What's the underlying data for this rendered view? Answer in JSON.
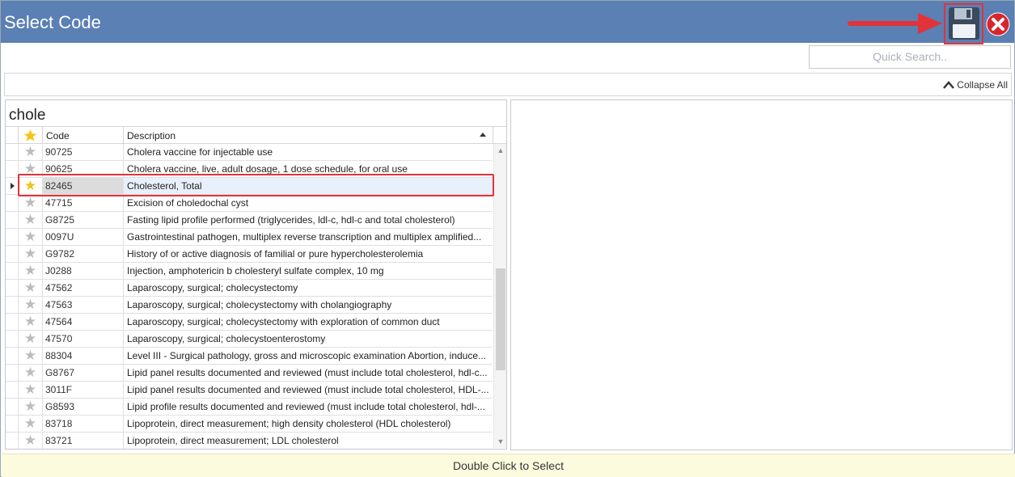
{
  "window": {
    "title": "Select Code"
  },
  "toolbar": {
    "save_icon": "floppy-disk-save-icon",
    "close_icon": "red-x-close-icon",
    "accent_color": "#5a80b4",
    "annotation_color": "#e2333a"
  },
  "search": {
    "placeholder": "Quick Search.."
  },
  "collapse": {
    "label": "Collapse All"
  },
  "group": {
    "title": "chole"
  },
  "grid": {
    "columns": {
      "code": "Code",
      "description": "Description"
    },
    "sort": "Description ascending",
    "selected_index": 2,
    "rows": [
      {
        "code": "90725",
        "description": "Cholera vaccine for injectable use",
        "favorite": false
      },
      {
        "code": "90625",
        "description": "Cholera vaccine, live, adult dosage, 1 dose schedule, for oral use",
        "favorite": false
      },
      {
        "code": "82465",
        "description": "Cholesterol, Total",
        "favorite": true
      },
      {
        "code": "47715",
        "description": "Excision of choledochal cyst",
        "favorite": false
      },
      {
        "code": "G8725",
        "description": "Fasting lipid profile performed (triglycerides, ldl-c, hdl-c and total cholesterol)",
        "favorite": false
      },
      {
        "code": "0097U",
        "description": "Gastrointestinal pathogen, multiplex reverse transcription and multiplex amplified...",
        "favorite": false
      },
      {
        "code": "G9782",
        "description": "History of or active diagnosis of familial or pure hypercholesterolemia",
        "favorite": false
      },
      {
        "code": "J0288",
        "description": "Injection, amphotericin b cholesteryl sulfate complex, 10 mg",
        "favorite": false
      },
      {
        "code": "47562",
        "description": "Laparoscopy, surgical; cholecystectomy",
        "favorite": false
      },
      {
        "code": "47563",
        "description": "Laparoscopy, surgical; cholecystectomy with cholangiography",
        "favorite": false
      },
      {
        "code": "47564",
        "description": "Laparoscopy, surgical; cholecystectomy with exploration of common duct",
        "favorite": false
      },
      {
        "code": "47570",
        "description": "Laparoscopy, surgical; cholecystoenterostomy",
        "favorite": false
      },
      {
        "code": "88304",
        "description": "Level III - Surgical pathology, gross and microscopic examination Abortion, induce...",
        "favorite": false
      },
      {
        "code": "G8767",
        "description": "Lipid panel results documented and reviewed (must include total cholesterol, hdl-c...",
        "favorite": false
      },
      {
        "code": "3011F",
        "description": "Lipid panel results documented and reviewed (must include total cholesterol, HDL-...",
        "favorite": false
      },
      {
        "code": "G8593",
        "description": "Lipid profile results documented and reviewed (must include total cholesterol, hdl-...",
        "favorite": false
      },
      {
        "code": "83718",
        "description": "Lipoprotein, direct measurement; high density cholesterol (HDL cholesterol)",
        "favorite": false
      },
      {
        "code": "83721",
        "description": "Lipoprotein, direct measurement; LDL cholesterol",
        "favorite": false
      }
    ]
  },
  "footer": {
    "hint": "Double Click to Select"
  }
}
